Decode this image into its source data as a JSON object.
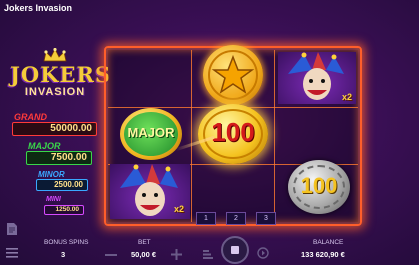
{
  "window": {
    "title": "Jokers Invasion"
  },
  "logo": {
    "line1": "JOKERS",
    "line2": "INVASION"
  },
  "jackpots": [
    {
      "label": "GRAND",
      "value": "50000.00",
      "color": "#ff3a3a"
    },
    {
      "label": "MAJOR",
      "value": "7500.00",
      "color": "#39d84a"
    },
    {
      "label": "MINOR",
      "value": "2500.00",
      "color": "#3aa8ff"
    },
    {
      "label": "MINI",
      "value": "1250.00",
      "color": "#d64aff"
    }
  ],
  "reels": {
    "cell_major_label": "MAJOR",
    "cell_center_value": "100",
    "cell_right_value": "100",
    "multiplier_top": "x2",
    "multiplier_bottom": "x2"
  },
  "paylines": [
    "1",
    "2",
    "3"
  ],
  "bottom_bar": {
    "bonus_spins_label": "BONUS SPINS",
    "bonus_spins_value": "3",
    "bet_label": "BET",
    "bet_value": "50,00 €",
    "balance_label": "BALANCE",
    "balance_value": "133 620,90 €"
  },
  "colors": {
    "frame": "#ff5e2a",
    "gold": "#f5cc3a",
    "background": "#3a0f55"
  }
}
